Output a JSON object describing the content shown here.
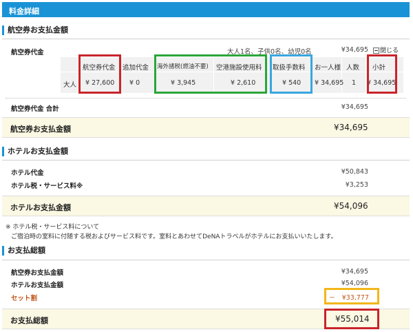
{
  "header": {
    "title": "料金詳細"
  },
  "airfare_section": {
    "title": "航空券お支払金額",
    "row_label": "航空券代金",
    "passengers_summary": "大人1名、子供0名、幼児0名",
    "summary_amount": "¥34,695",
    "close_label": "閉じる",
    "table": {
      "headers": [
        "航空券代金",
        "追加代金",
        "海外諸税(燃油不要)",
        "空港施設使用料",
        "取扱手数料",
        "お一人様",
        "人数",
        "小計"
      ],
      "row": {
        "type": "大人",
        "cells": [
          "¥ 27,600",
          "¥ 0",
          "¥ 3,945",
          "¥ 2,610",
          "¥ 540",
          "¥ 34,695",
          "1",
          "¥ 34,695"
        ]
      }
    },
    "total_label": "航空券代金 合計",
    "total_amount": "¥34,695",
    "pay_label": "航空券お支払金額",
    "pay_amount": "¥34,695"
  },
  "hotel_section": {
    "title": "ホテルお支払金額",
    "rows": [
      {
        "label": "ホテル代金",
        "amount": "¥50,843"
      },
      {
        "label": "ホテル税・サービス料※",
        "amount": "¥3,253"
      }
    ],
    "pay_label": "ホテルお支払金額",
    "pay_amount": "¥54,096",
    "note_line1": "※ ホテル税・サービス料について",
    "note_line2": "ご宿泊時の室料に付随する税およびサービス料です。室料とあわせてDeNAトラベルがホテルにお支払いいたします。"
  },
  "total_section": {
    "title": "お支払総額",
    "rows": [
      {
        "label": "航空券お支払金額",
        "amount": "¥34,695"
      },
      {
        "label": "ホテルお支払金額",
        "amount": "¥54,096"
      }
    ],
    "discount_label": "セット割",
    "discount_amount": "－　¥33,777",
    "grand_label": "お支払総額",
    "grand_amount": "¥55,014"
  },
  "colors": {
    "header_blue": "#1a93d6",
    "band_yellow": "#fbf8e3",
    "highlight_red": "#c8242b",
    "highlight_green": "#2aa63a",
    "highlight_blue": "#38a6e0",
    "highlight_yellow": "#f2b619",
    "discount_text": "#c0571b"
  }
}
